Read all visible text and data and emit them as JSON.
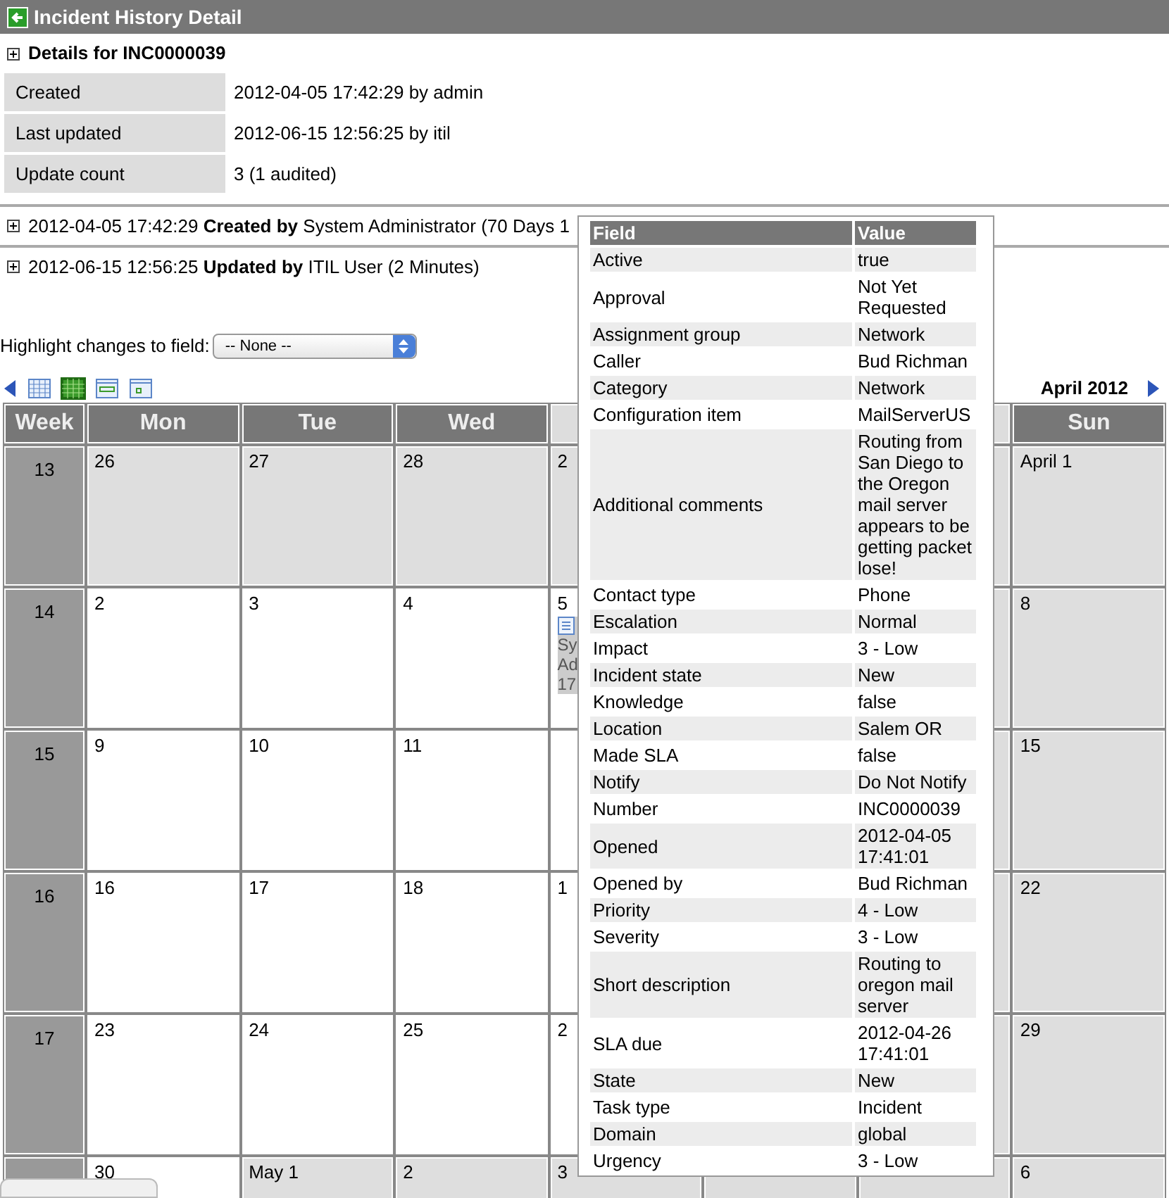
{
  "window": {
    "title": "Incident History Detail"
  },
  "details": {
    "heading": "Details for INC0000039",
    "rows": [
      {
        "label": "Created",
        "value": "2012-04-05 17:42:29 by admin"
      },
      {
        "label": "Last updated",
        "value": "2012-06-15 12:56:25 by itil"
      },
      {
        "label": "Update count",
        "value": "3 (1 audited)"
      }
    ]
  },
  "history": [
    {
      "text": "2012-04-05 17:42:29 **Created by** System Administrator (70 Days 1"
    },
    {
      "text": "2012-06-15 12:56:25 **Updated by** ITIL User (2 Minutes)"
    }
  ],
  "highlight": {
    "label": "Highlight changes to field:",
    "value": "-- None --"
  },
  "calendar": {
    "title": "April 2012",
    "view_buttons": [
      {
        "selected": false
      },
      {
        "selected": true
      },
      {
        "selected": false
      },
      {
        "selected": false
      }
    ],
    "columns": [
      "Week",
      "Mon",
      "Tue",
      "Wed",
      "Sun"
    ],
    "weeks": [
      {
        "week": "13",
        "days": [
          {
            "date": "26",
            "shaded": true
          },
          {
            "date": "27",
            "shaded": true
          },
          {
            "date": "28",
            "shaded": true
          },
          {
            "date": "2",
            "shaded": true
          },
          {
            "date": "April 1",
            "shaded": true
          }
        ]
      },
      {
        "week": "14",
        "days": [
          {
            "date": "2",
            "shaded": false
          },
          {
            "date": "3",
            "shaded": false
          },
          {
            "date": "4",
            "shaded": false
          },
          {
            "date": "5",
            "shaded": false,
            "event": "Sy Ad 17"
          },
          {
            "date": "8",
            "shaded": true
          }
        ]
      },
      {
        "week": "15",
        "days": [
          {
            "date": "9",
            "shaded": false
          },
          {
            "date": "10",
            "shaded": false
          },
          {
            "date": "11",
            "shaded": false
          },
          {
            "shaded": false
          },
          {
            "date": "15",
            "shaded": true
          }
        ]
      },
      {
        "week": "16",
        "days": [
          {
            "date": "16",
            "shaded": false
          },
          {
            "date": "17",
            "shaded": false
          },
          {
            "date": "18",
            "shaded": false
          },
          {
            "date": "1",
            "shaded": false
          },
          {
            "date": "22",
            "shaded": true
          }
        ]
      },
      {
        "week": "17",
        "days": [
          {
            "date": "23",
            "shaded": false
          },
          {
            "date": "24",
            "shaded": false
          },
          {
            "date": "25",
            "shaded": false
          },
          {
            "date": "2",
            "shaded": false
          },
          {
            "date": "29",
            "shaded": true
          }
        ]
      },
      {
        "days": [
          {
            "date": "30",
            "shaded": false
          },
          {
            "date": "May 1",
            "shaded": true
          },
          {
            "date": "2",
            "shaded": true
          },
          {
            "date": "3",
            "shaded": true
          },
          {
            "date": "6",
            "shaded": true
          }
        ]
      }
    ]
  },
  "popup": {
    "columns": [
      "Field",
      "Value"
    ],
    "rows": [
      {
        "field": "Active",
        "value": "true"
      },
      {
        "field": "Approval",
        "value": "Not Yet Requested"
      },
      {
        "field": "Assignment group",
        "value": "Network"
      },
      {
        "field": "Caller",
        "value": "Bud Richman"
      },
      {
        "field": "Category",
        "value": "Network"
      },
      {
        "field": "Configuration item",
        "value": "MailServerUS"
      },
      {
        "field": "Additional comments",
        "value": "Routing from San Diego to the Oregon mail server appears to be getting packet lose!"
      },
      {
        "field": "Contact type",
        "value": "Phone"
      },
      {
        "field": "Escalation",
        "value": "Normal"
      },
      {
        "field": "Impact",
        "value": "3 - Low"
      },
      {
        "field": "Incident state",
        "value": "New"
      },
      {
        "field": "Knowledge",
        "value": "false"
      },
      {
        "field": "Location",
        "value": "Salem OR"
      },
      {
        "field": "Made SLA",
        "value": "false"
      },
      {
        "field": "Notify",
        "value": "Do Not Notify"
      },
      {
        "field": "Number",
        "value": "INC0000039"
      },
      {
        "field": "Opened",
        "value": "2012-04-05 17:41:01"
      },
      {
        "field": "Opened by",
        "value": "Bud Richman"
      },
      {
        "field": "Priority",
        "value": "4 - Low"
      },
      {
        "field": "Severity",
        "value": "3 - Low"
      },
      {
        "field": "Short description",
        "value": "Routing to oregon mail server"
      },
      {
        "field": "SLA due",
        "value": "2012-04-26 17:41:01"
      },
      {
        "field": "State",
        "value": "New"
      },
      {
        "field": "Task type",
        "value": "Incident"
      },
      {
        "field": "Domain",
        "value": "global"
      },
      {
        "field": "Urgency",
        "value": "3 - Low"
      }
    ]
  }
}
